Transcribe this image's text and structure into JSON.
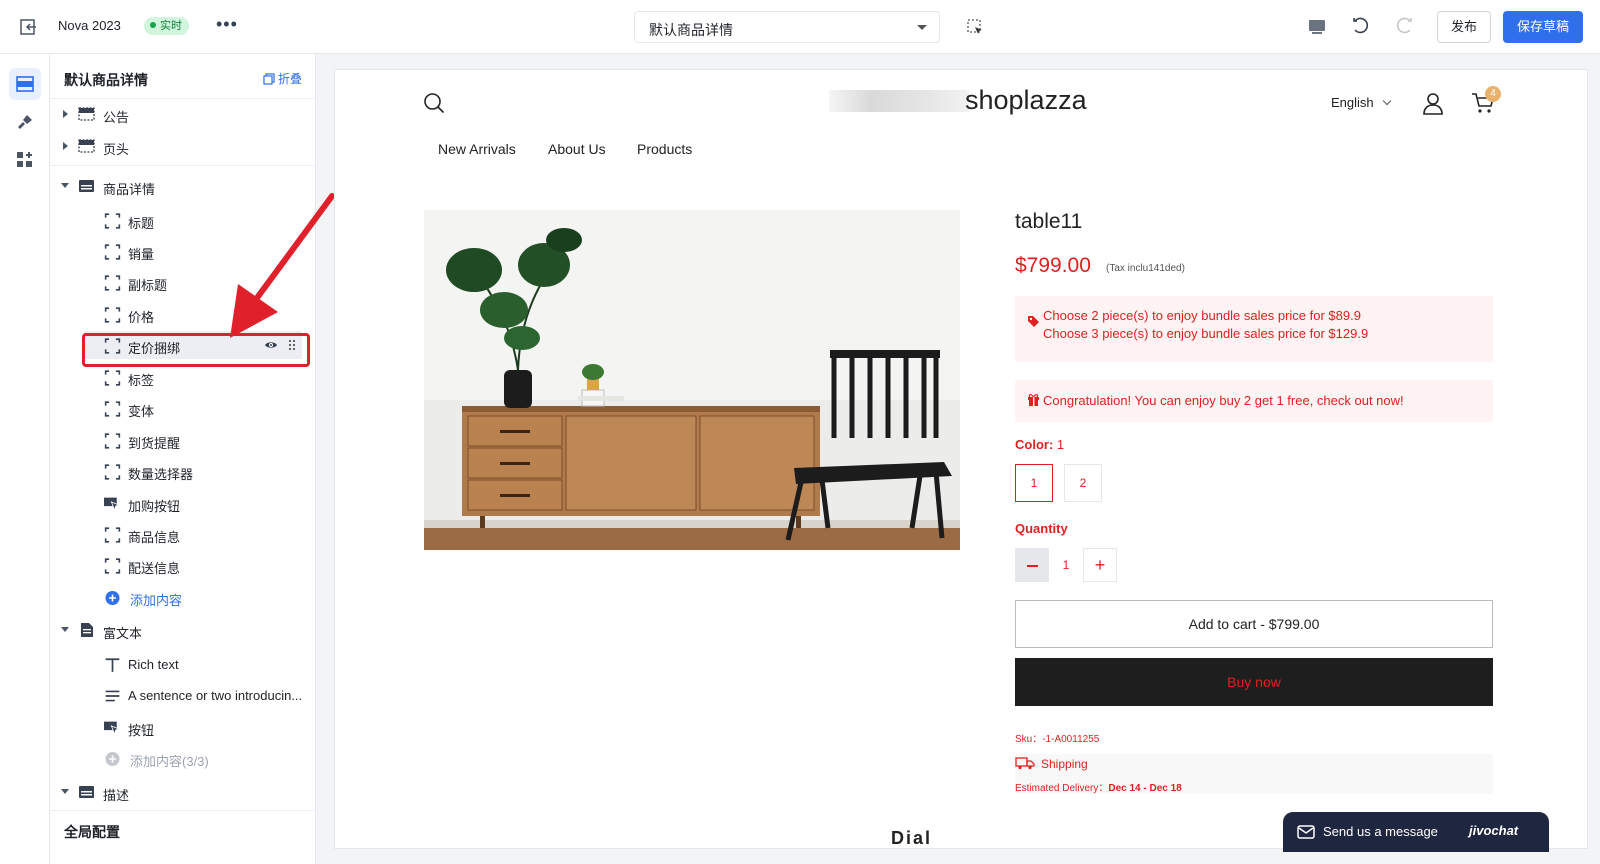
{
  "topbar": {
    "store_name": "Nova 2023",
    "live_badge": "实时",
    "more": "•••",
    "template_select": "默认商品详情",
    "publish_label": "发布",
    "save_draft_label": "保存草稿"
  },
  "sidebar": {
    "title": "默认商品详情",
    "fold_label": "折叠",
    "sections": {
      "announcement": "公告",
      "header": "页头",
      "product_detail": "商品详情",
      "rich_text": "富文本",
      "description": "描述"
    },
    "product_blocks": [
      "标题",
      "销量",
      "副标题",
      "价格",
      "定价捆绑",
      "标签",
      "变体",
      "到货提醒",
      "数量选择器",
      "加购按钮",
      "商品信息",
      "配送信息"
    ],
    "add_content": "添加内容",
    "rich_text_blocks": [
      "Rich text",
      "A sentence or two introducin...",
      "按钮"
    ],
    "add_content_limit": "添加内容(3/3)",
    "global_config": "全局配置"
  },
  "preview": {
    "logo_text": "shoplazza",
    "language": "English",
    "cart_count": "4",
    "nav": [
      "New Arrivals",
      "About Us",
      "Products"
    ],
    "product": {
      "title": "table11",
      "price": "$799.00",
      "tax_note": "(Tax inclu141ded)",
      "bundle_lines": [
        "Choose 2 piece(s) to enjoy bundle sales price for $89.9",
        "Choose 3 piece(s) to enjoy bundle sales price for $129.9"
      ],
      "congrats": "Congratulation! You can enjoy buy 2 get 1 free, check out now!",
      "color_label": "Color:",
      "color_value": "1",
      "color_options": [
        "1",
        "2"
      ],
      "quantity_label": "Quantity",
      "quantity": "1",
      "add_to_cart": "Add to cart  -  $799.00",
      "buy_now": "Buy now",
      "sku": "Sku：-1-A0011255",
      "shipping_title": "Shipping",
      "estimated_label": "Estimated Delivery：",
      "estimated_value": "Dec 14 - Dec 18"
    },
    "cut_text": "Dial"
  },
  "chat": {
    "label": "Send us a message",
    "brand": "jivochat"
  },
  "colors": {
    "accent": "#2f6fec",
    "sale_red": "#e02020",
    "highlight_red": "#e0202b",
    "live_green": "#16a34a"
  }
}
